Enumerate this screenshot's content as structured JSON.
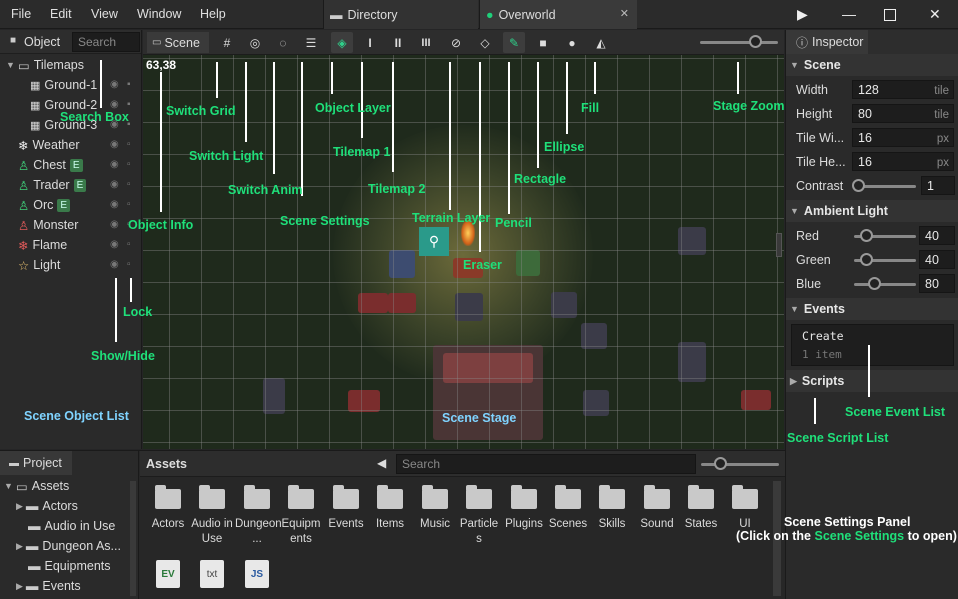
{
  "menubar": {
    "items": [
      "File",
      "Edit",
      "View",
      "Window",
      "Help"
    ],
    "tabs": [
      {
        "label": "Directory",
        "icon": "folder-icon"
      },
      {
        "label": "Overworld",
        "icon": "globe-icon",
        "close": "✕"
      }
    ]
  },
  "object_panel": {
    "tab": "Object",
    "search_placeholder": "Search",
    "tree": [
      {
        "label": "Tilemaps",
        "icon": "folder-open-icon",
        "depth": 0
      },
      {
        "label": "Ground-1",
        "icon": "tilemap-icon",
        "depth": 1
      },
      {
        "label": "Ground-2",
        "icon": "tilemap-icon",
        "depth": 1
      },
      {
        "label": "Ground-3",
        "icon": "tilemap-icon",
        "depth": 1
      },
      {
        "label": "Weather",
        "icon": "snowflake-icon",
        "depth": 0
      },
      {
        "label": "Chest",
        "icon": "person-icon",
        "badge": "E",
        "depth": 0
      },
      {
        "label": "Trader",
        "icon": "person-icon",
        "badge": "E",
        "depth": 0
      },
      {
        "label": "Orc",
        "icon": "person-icon",
        "badge": "E",
        "depth": 0
      },
      {
        "label": "Monster",
        "icon": "person-icon",
        "depth": 0
      },
      {
        "label": "Flame",
        "icon": "snowflake-icon",
        "depth": 0
      },
      {
        "label": "Light",
        "icon": "star-icon",
        "depth": 0
      }
    ]
  },
  "scene_toolbar": {
    "tab": "Scene",
    "coords": "63,38"
  },
  "inspector": {
    "tab": "Inspector",
    "scene": {
      "title": "Scene",
      "width": {
        "label": "Width",
        "value": "128",
        "unit": "tile"
      },
      "height": {
        "label": "Height",
        "value": "80",
        "unit": "tile"
      },
      "tile_width": {
        "label": "Tile Wi...",
        "value": "16",
        "unit": "px"
      },
      "tile_height": {
        "label": "Tile He...",
        "value": "16",
        "unit": "px"
      },
      "contrast": {
        "label": "Contrast",
        "value": "1"
      }
    },
    "ambient": {
      "title": "Ambient Light",
      "red": {
        "label": "Red",
        "value": "40"
      },
      "green": {
        "label": "Green",
        "value": "40"
      },
      "blue": {
        "label": "Blue",
        "value": "80"
      }
    },
    "events": {
      "title": "Events",
      "item": "Create",
      "count": "1 item"
    },
    "scripts": {
      "title": "Scripts"
    }
  },
  "project_panel": {
    "tab": "Project",
    "tree": [
      "Assets",
      "Actors",
      "Audio in Use",
      "Dungeon As...",
      "Equipments",
      "Events"
    ]
  },
  "assets_panel": {
    "title": "Assets",
    "search_placeholder": "Search",
    "folders": [
      "Actors",
      "Audio in Use",
      "Dungeon ...",
      "Equipm ents",
      "Events",
      "Items",
      "Music",
      "Particle s",
      "Plugins",
      "Scenes",
      "Skills",
      "Sound",
      "States",
      "UI"
    ],
    "files": [
      "EV",
      "txt",
      "JS"
    ]
  },
  "annotations": {
    "search_box": "Search Box",
    "switch_grid": "Switch Grid",
    "switch_light": "Switch Light",
    "switch_anim": "Switch Anim",
    "object_layer": "Object Layer",
    "tilemap1": "Tilemap 1",
    "tilemap2": "Tilemap 2",
    "terrain_layer": "Terrain Layer",
    "eraser": "Eraser",
    "pencil": "Pencil",
    "rectangle": "Rectagle",
    "ellipse": "Ellipse",
    "fill": "Fill",
    "stage_zoom": "Stage Zoom",
    "scene_settings": "Scene Settings",
    "object_info": "Object Info",
    "lock": "Lock",
    "show_hide": "Show/Hide",
    "scene_object_list": "Scene Object List",
    "scene_stage": "Scene Stage",
    "scene_event_list": "Scene Event List",
    "scene_script_list": "Scene Script List",
    "settings_panel_title": "Scene Settings Panel",
    "settings_panel_hint_pre": "(Click on the ",
    "settings_panel_hint_link": "Scene Settings",
    "settings_panel_hint_post": " to open)"
  },
  "colors": {
    "annotation_green": "#1fe07a",
    "annotation_blue": "#7fd3ff",
    "terrain_tool_bg": "#2a9a8a"
  }
}
